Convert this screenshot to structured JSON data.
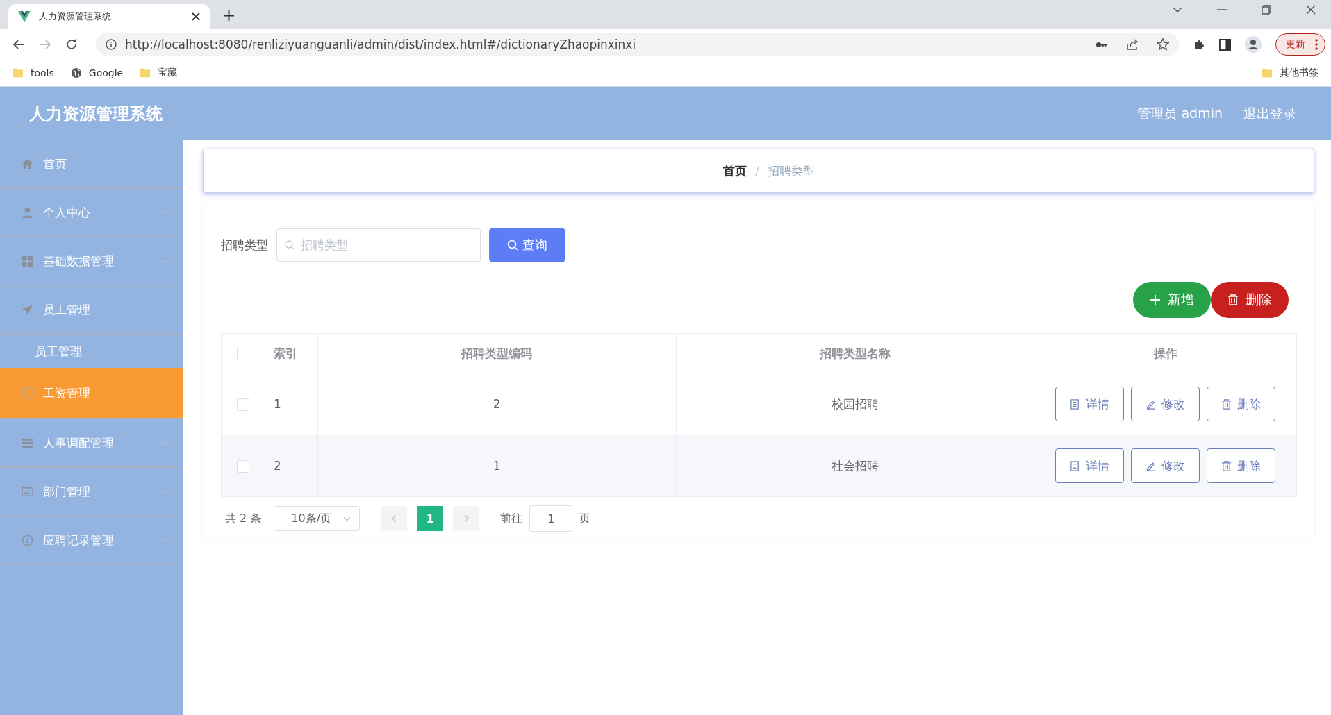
{
  "browser": {
    "tab_title": "人力资源管理系统",
    "url": "http://localhost:8080/renliziyuanguanli/admin/dist/index.html#/dictionaryZhaopinxinxi",
    "update_button": "更新",
    "bookmarks": [
      {
        "label": "tools",
        "kind": "folder"
      },
      {
        "label": "Google",
        "kind": "globe"
      },
      {
        "label": "宝藏",
        "kind": "folder"
      }
    ],
    "other_bookmarks": "其他书签"
  },
  "header": {
    "title": "人力资源管理系统",
    "user": "管理员 admin",
    "logout": "退出登录"
  },
  "sidebar": {
    "items": [
      {
        "label": "首页",
        "selected": false
      },
      {
        "label": "个人中心",
        "selected": false,
        "expanded": false
      },
      {
        "label": "基础数据管理",
        "selected": false,
        "expanded": false
      },
      {
        "label": "员工管理",
        "selected": false,
        "expanded": true,
        "children": [
          {
            "label": "员工管理",
            "selected": false
          },
          {
            "label": "工资管理",
            "selected": true
          }
        ]
      },
      {
        "label": "人事调配管理",
        "selected": false,
        "expanded": false
      },
      {
        "label": "部门管理",
        "selected": false,
        "expanded": false
      },
      {
        "label": "应聘记录管理",
        "selected": false,
        "expanded": false
      }
    ]
  },
  "breadcrumb": [
    {
      "label": "首页",
      "current": false
    },
    {
      "label": "招聘类型",
      "current": true
    }
  ],
  "breadcrumb_separator": "/",
  "search": {
    "label": "招聘类型",
    "placeholder": "招聘类型",
    "button": "查询"
  },
  "toolbar": {
    "add_button": "新增",
    "delete_button": "删除"
  },
  "table": {
    "all_selected": false,
    "columns": [
      "索引",
      "招聘类型编码",
      "招聘类型名称",
      "操作"
    ],
    "rows": [
      {
        "selected": false,
        "cells": [
          "1",
          "2",
          "校园招聘"
        ],
        "actions": [
          "详情",
          "修改",
          "删除"
        ]
      },
      {
        "selected": false,
        "cells": [
          "2",
          "1",
          "社会招聘"
        ],
        "actions": [
          "详情",
          "修改",
          "删除"
        ]
      }
    ]
  },
  "pagination": {
    "total": "共 2 条",
    "page_size": "10条/页",
    "pages": [
      {
        "label": "1",
        "selected": true
      }
    ],
    "goto_label": "前往",
    "goto_value": "1",
    "page_suffix": "页"
  }
}
